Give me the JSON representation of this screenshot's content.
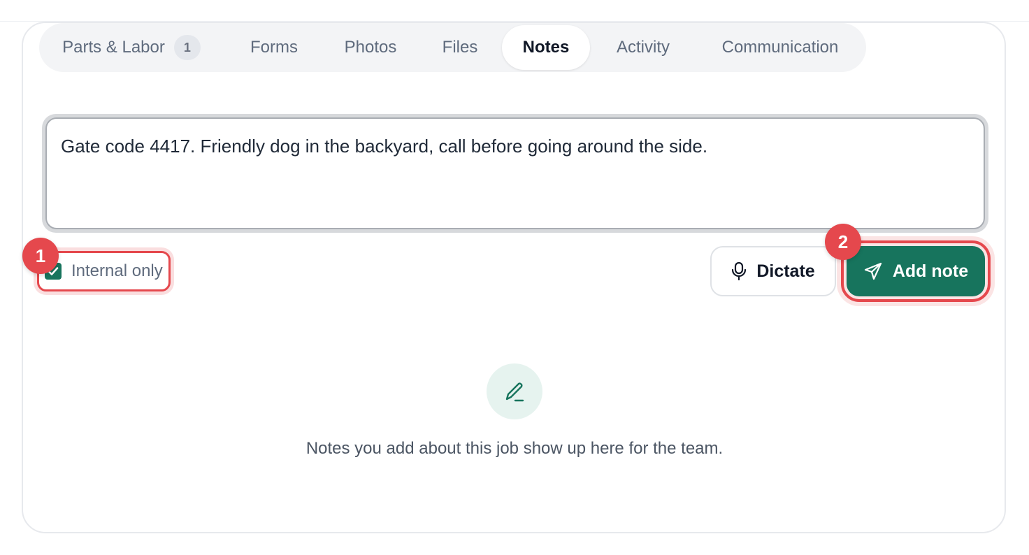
{
  "tabs": [
    {
      "label": "Parts & Labor",
      "badge": "1"
    },
    {
      "label": "Forms"
    },
    {
      "label": "Photos"
    },
    {
      "label": "Files"
    },
    {
      "label": "Notes",
      "active": true
    },
    {
      "label": "Activity"
    },
    {
      "label": "Communication"
    }
  ],
  "note": {
    "value": "Gate code 4417. Friendly dog in the backyard, call before going around the side."
  },
  "internal_only": {
    "label": "Internal only",
    "checked": true
  },
  "buttons": {
    "dictate": {
      "label": "Dictate",
      "icon": "microphone-icon"
    },
    "add_note": {
      "label": "Add note",
      "icon": "send-icon"
    }
  },
  "markers": [
    "1",
    "2"
  ],
  "empty_state": {
    "icon": "pencil-icon",
    "text": "Notes you add about this job show up here for the team."
  },
  "colors": {
    "accent": "#17745d",
    "highlight": "#e5484d"
  }
}
